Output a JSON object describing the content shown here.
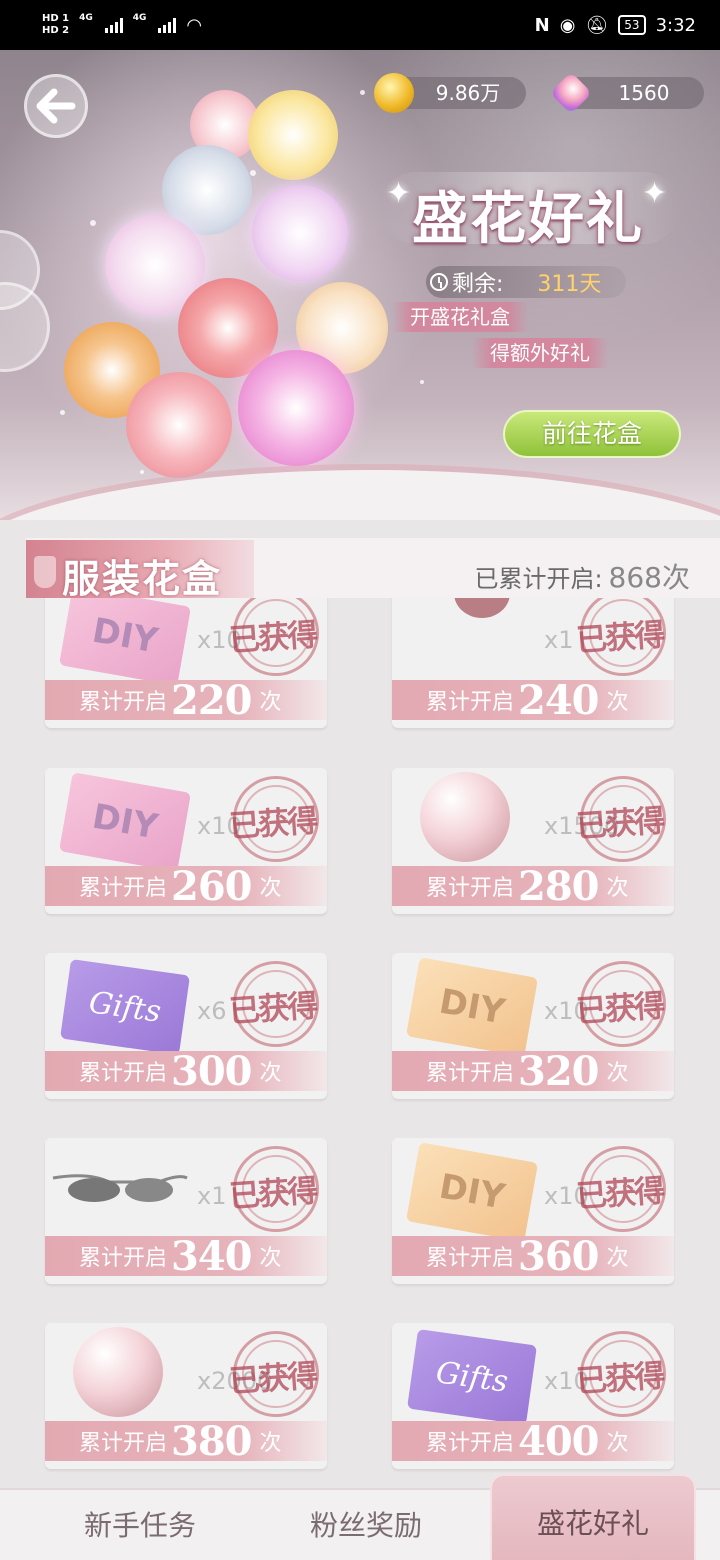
{
  "status_bar": {
    "hd1": "HD 1",
    "hd2": "HD 2",
    "net1": "4G",
    "net2": "4G",
    "battery": "53",
    "time": "3:32"
  },
  "header": {
    "coins": "9.86万",
    "gems": "1560",
    "event_title": "盛花好礼",
    "remaining_label": "剩余:",
    "remaining_value": "311天",
    "tag1": "开盛花礼盒",
    "tag2": "得额外好礼",
    "go_button": "前往花盒"
  },
  "section": {
    "title": "服装花盒",
    "total_label": "已累计开启:",
    "total_value": "868次"
  },
  "rewards": [
    {
      "item": "diy-pink",
      "qty": "x10",
      "stamp": "已获得",
      "prefix": "累计开启",
      "count": "220",
      "suffix": "次"
    },
    {
      "item": "strawberry",
      "qty": "x1",
      "stamp": "已获得",
      "prefix": "累计开启",
      "count": "240",
      "suffix": "次"
    },
    {
      "item": "diy-pink",
      "qty": "x10",
      "stamp": "已获得",
      "prefix": "累计开启",
      "count": "260",
      "suffix": "次"
    },
    {
      "item": "dress-orb",
      "qty": "x1500",
      "stamp": "已获得",
      "prefix": "累计开启",
      "count": "280",
      "suffix": "次"
    },
    {
      "item": "gifts-card",
      "qty": "x6",
      "stamp": "已获得",
      "prefix": "累计开启",
      "count": "300",
      "suffix": "次",
      "card_text": "Gifts"
    },
    {
      "item": "diy-gold",
      "qty": "x10",
      "stamp": "已获得",
      "prefix": "累计开启",
      "count": "320",
      "suffix": "次"
    },
    {
      "item": "sunglasses",
      "qty": "x1",
      "stamp": "已获得",
      "prefix": "累计开启",
      "count": "340",
      "suffix": "次"
    },
    {
      "item": "diy-gold",
      "qty": "x10",
      "stamp": "已获得",
      "prefix": "累计开启",
      "count": "360",
      "suffix": "次"
    },
    {
      "item": "dress-orb",
      "qty": "x2000",
      "stamp": "已获得",
      "prefix": "累计开启",
      "count": "380",
      "suffix": "次"
    },
    {
      "item": "gifts-card",
      "qty": "x10",
      "stamp": "已获得",
      "prefix": "累计开启",
      "count": "400",
      "suffix": "次",
      "card_text": "Gifts"
    }
  ],
  "diy_text": "DIY",
  "nav": {
    "tabs": [
      "新手任务",
      "粉丝奖励",
      "盛花好礼"
    ],
    "active": 2
  },
  "colors": {
    "accent_pink": "#e3a9b2",
    "go_green": "#8fc23a",
    "gold_text": "#ffd36a"
  }
}
